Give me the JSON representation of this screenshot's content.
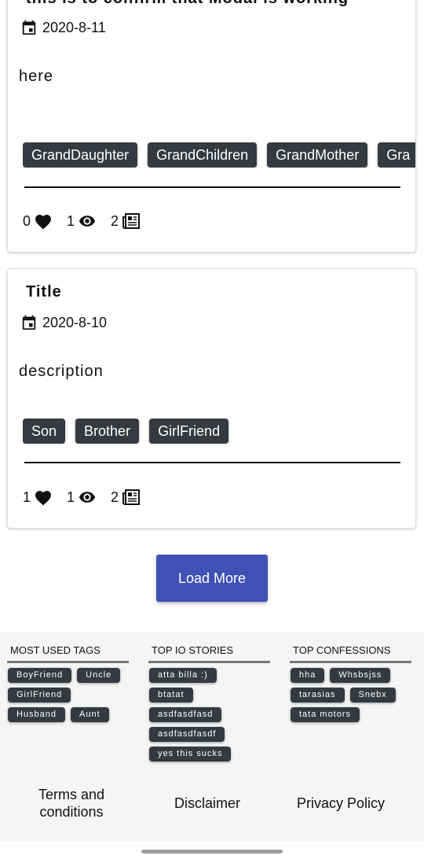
{
  "posts": [
    {
      "title": "this is to confirm that Modal is working",
      "date": "2020-8-11",
      "description": "here",
      "tags": [
        "GrandDaughter",
        "GrandChildren",
        "GrandMother",
        "Gra"
      ],
      "likes": "0",
      "views": "1",
      "comments": "2"
    },
    {
      "title": "Title",
      "date": "2020-8-10",
      "description": "description",
      "tags": [
        "Son",
        "Brother",
        "GirlFriend"
      ],
      "likes": "1",
      "views": "1",
      "comments": "2"
    }
  ],
  "load_more_label": "Load More",
  "footer": {
    "most_used_tags": {
      "heading": "MOST USED TAGS",
      "items": [
        "BoyFriend",
        "Uncle",
        "GirlFriend",
        "Husband",
        "Aunt"
      ]
    },
    "top_io_stories": {
      "heading": "TOP IO STORIES",
      "items": [
        "atta billa :)",
        "btatat",
        "asdfasdfasd",
        "asdfasdfasdf",
        "yes this sucks"
      ]
    },
    "top_confessions": {
      "heading": "TOP CONFESSIONS",
      "items": [
        "hha",
        "Whsbsjss",
        "tarasias",
        "Snebx",
        "tata motors"
      ]
    },
    "links": {
      "terms": "Terms and conditions",
      "disclaimer": "Disclaimer",
      "privacy": "Privacy Policy"
    }
  },
  "colors": {
    "tag_bg": "#343a40",
    "button_bg": "#3f51b5",
    "footer_bg": "#f5f5f5"
  },
  "icons": [
    "calendar-icon",
    "heart-icon",
    "eye-icon",
    "newspaper-icon"
  ]
}
